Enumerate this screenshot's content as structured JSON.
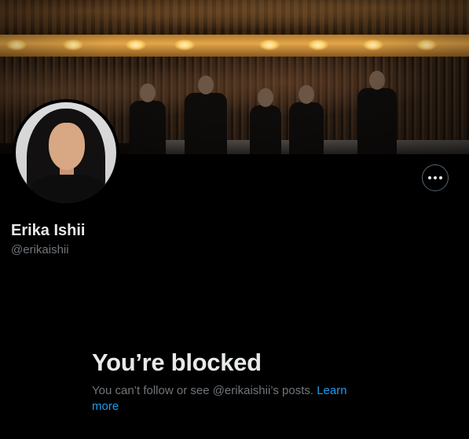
{
  "profile": {
    "display_name": "Erika Ishii",
    "handle": "@erikaishii",
    "banner_icon": "theater-stage-photo",
    "avatar_icon": "profile-photo"
  },
  "actions": {
    "more_icon": "more-horizontal-icon"
  },
  "blocked": {
    "title": "You’re blocked",
    "message": "You can’t follow or see @erikaishii’s posts.",
    "learn_more": "Learn more"
  },
  "colors": {
    "background": "#000000",
    "text_primary": "#e7e9ea",
    "text_secondary": "#71767b",
    "link": "#1d9bf0",
    "border": "#536471"
  }
}
